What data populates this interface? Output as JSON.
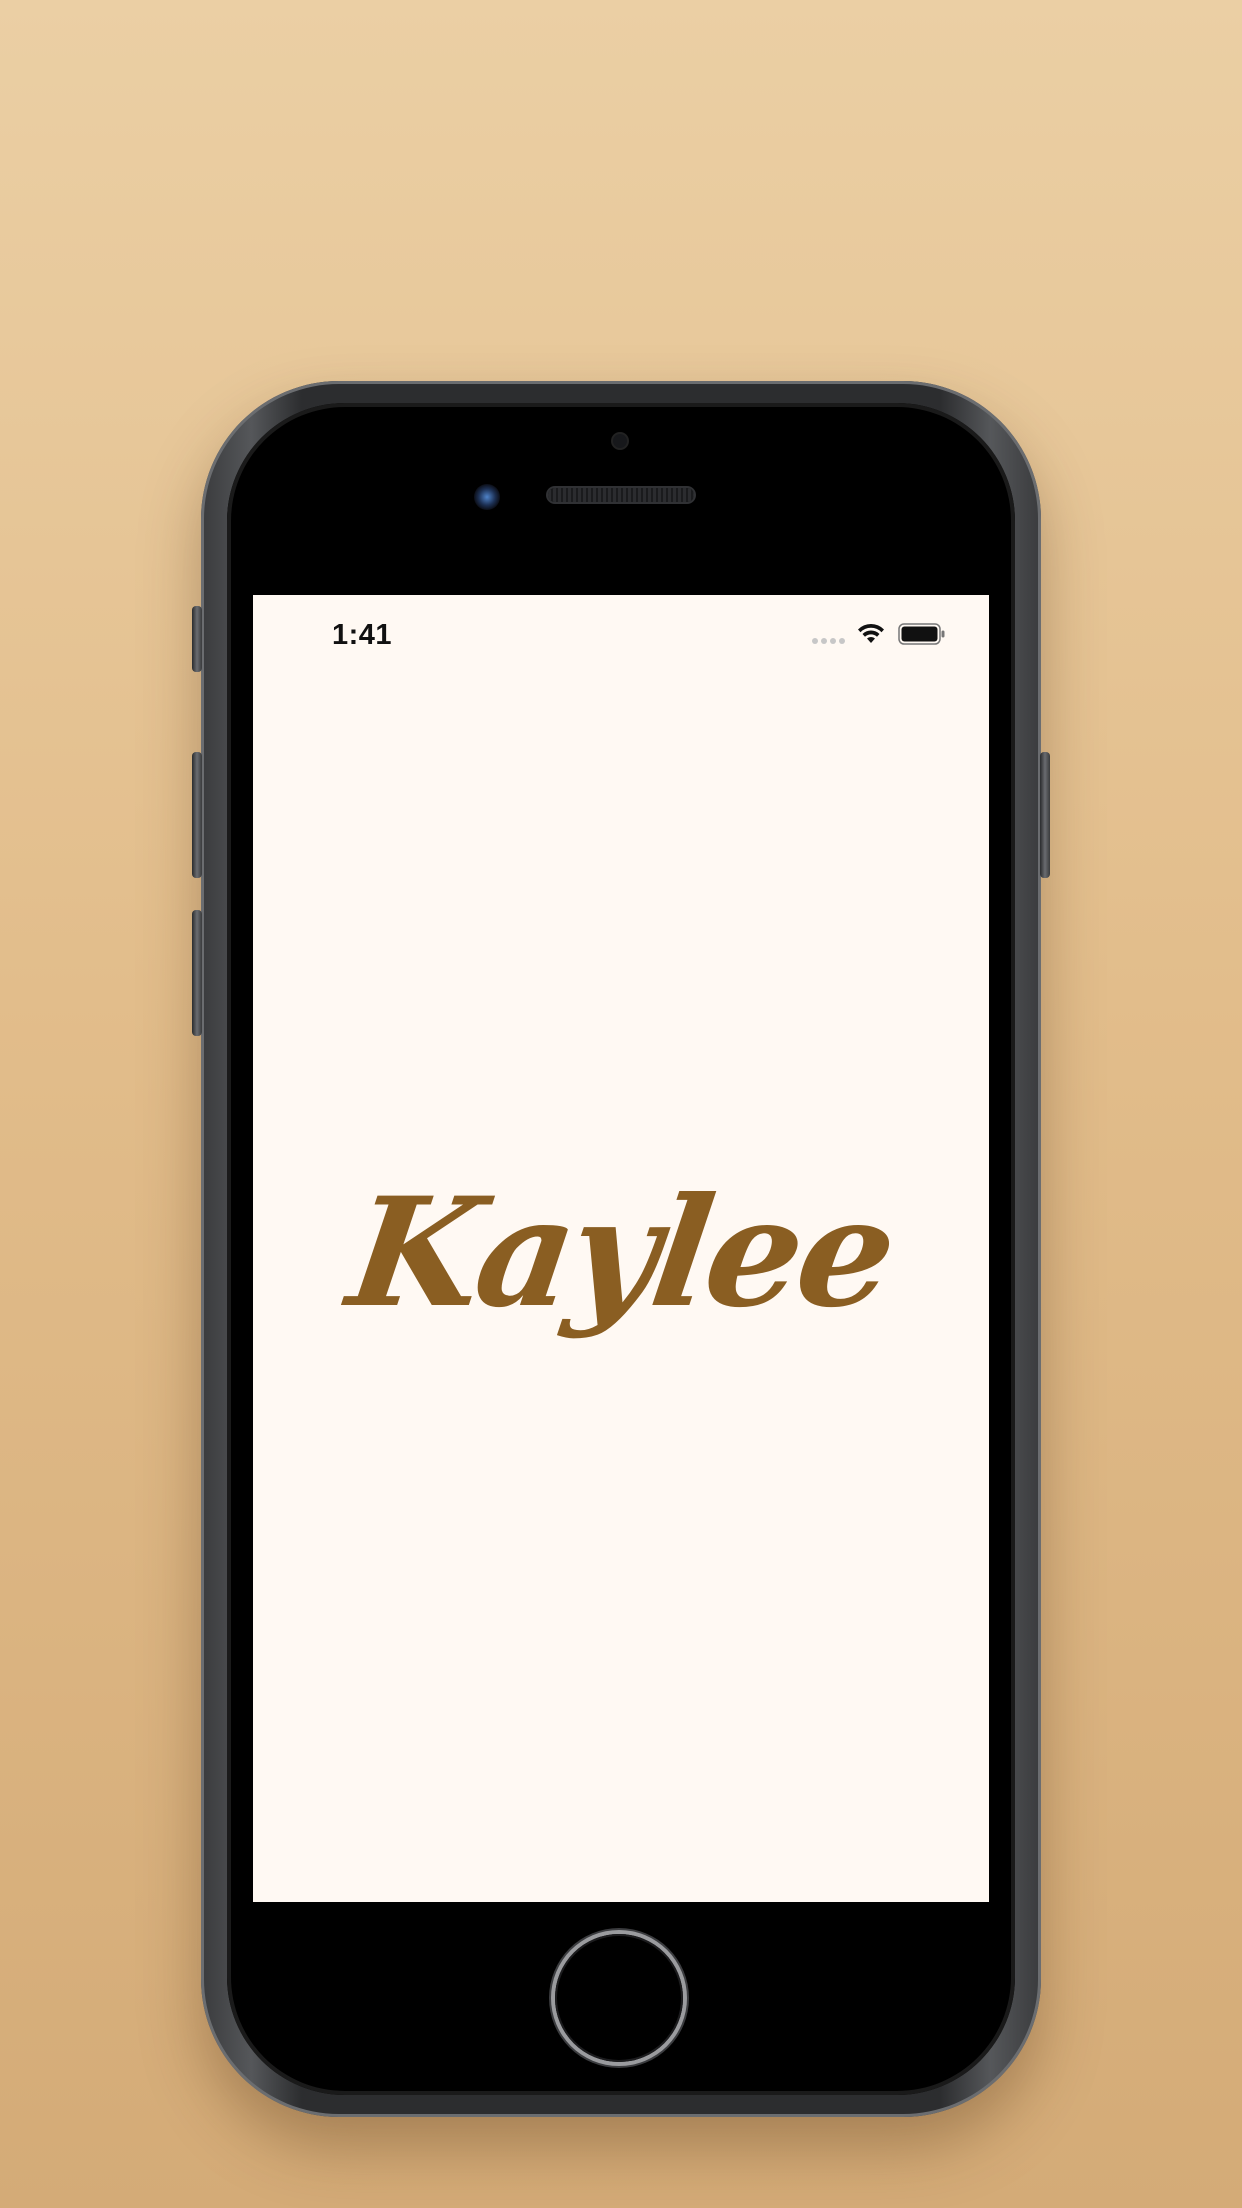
{
  "status_bar": {
    "time": "1:41",
    "signal_icon": "signal-bars-icon",
    "wifi_icon": "wifi-icon",
    "battery_icon": "battery-icon"
  },
  "app": {
    "logo_text": "Kaylee",
    "logo_color": "#8a5e22",
    "background_color": "#fff9f3"
  },
  "device": {
    "home_button_icon": "home-button-icon",
    "camera_icon": "front-camera-icon",
    "speaker_icon": "earpiece-speaker-icon"
  }
}
